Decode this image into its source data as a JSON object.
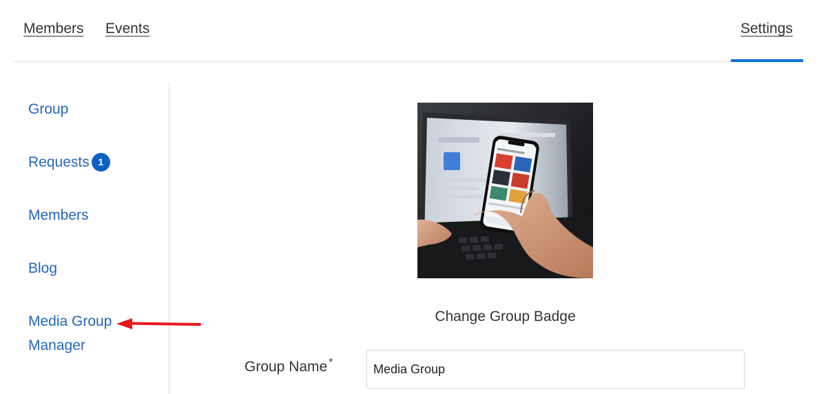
{
  "tabs": {
    "members": "Members",
    "events": "Events",
    "settings": "Settings",
    "active": "settings"
  },
  "sidebar": {
    "items": [
      {
        "id": "group",
        "label": "Group"
      },
      {
        "id": "requests",
        "label": "Requests",
        "badge": "1"
      },
      {
        "id": "members",
        "label": "Members"
      },
      {
        "id": "blog",
        "label": "Blog"
      },
      {
        "id": "media-group-manager",
        "label": "Media Group Manager"
      }
    ]
  },
  "main": {
    "badge_image": {
      "alt": "Group badge photo"
    },
    "change_badge_label": "Change Group Badge",
    "group_name": {
      "label": "Group Name",
      "required_mark": "*",
      "value": "Media Group"
    }
  },
  "colors": {
    "link": "#2467bb",
    "accent": "#0b6dd6",
    "badge": "#0b5fc7",
    "annotation_arrow": "#e8191b"
  },
  "icons": {
    "annotation": "left-arrow-icon"
  }
}
